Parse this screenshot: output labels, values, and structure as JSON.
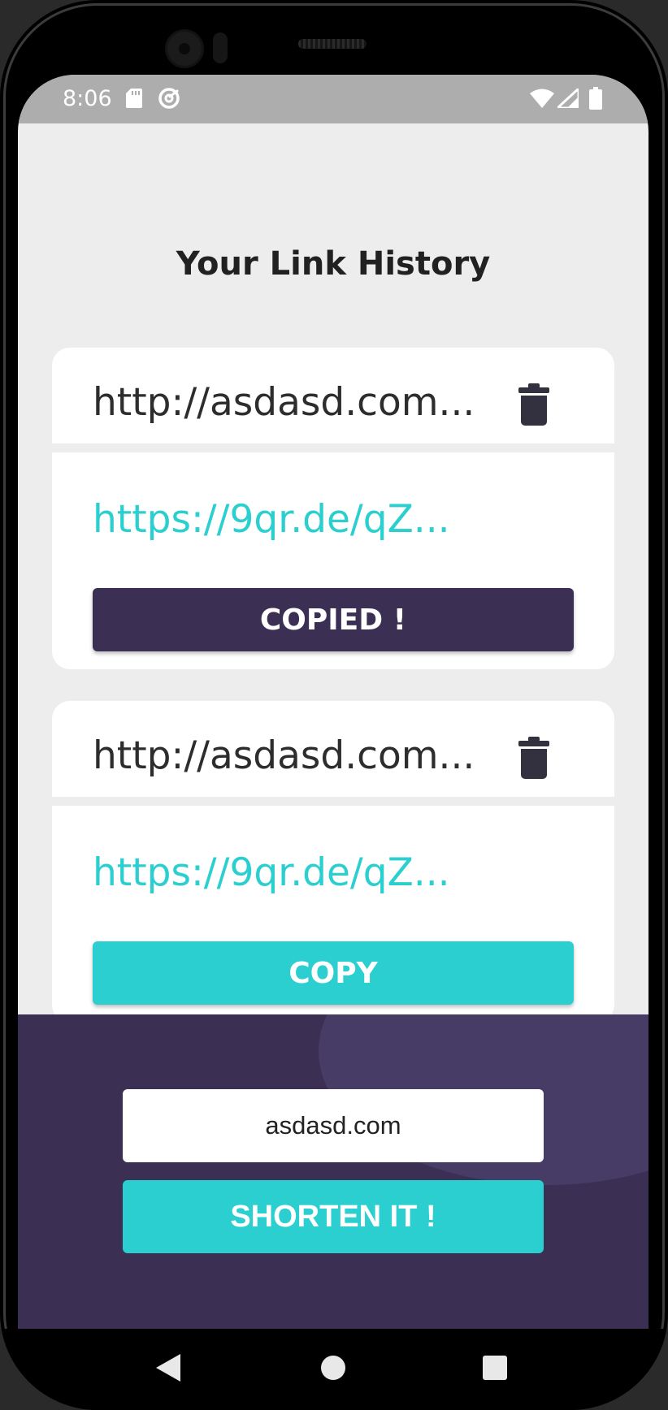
{
  "status_bar": {
    "time": "8:06"
  },
  "page": {
    "title": "Your Link History"
  },
  "history": [
    {
      "original_url": "http://asdasd.com...",
      "short_url": "https://9qr.de/qZ...",
      "button_label": "COPIED !",
      "copied": true
    },
    {
      "original_url": "http://asdasd.com...",
      "short_url": "https://9qr.de/qZ...",
      "button_label": "COPY",
      "copied": false
    }
  ],
  "shortener": {
    "input_value": "asdasd.com",
    "button_label": "SHORTEN IT !"
  },
  "colors": {
    "accent_cyan": "#2bcfcf",
    "dark_violet": "#3b3054",
    "background": "#ededed",
    "status_bar": "#adadad"
  },
  "icons": [
    "sd-card-icon",
    "sync-icon",
    "wifi-icon",
    "signal-icon",
    "battery-icon",
    "trash-icon",
    "back-icon",
    "home-icon",
    "recents-icon"
  ]
}
